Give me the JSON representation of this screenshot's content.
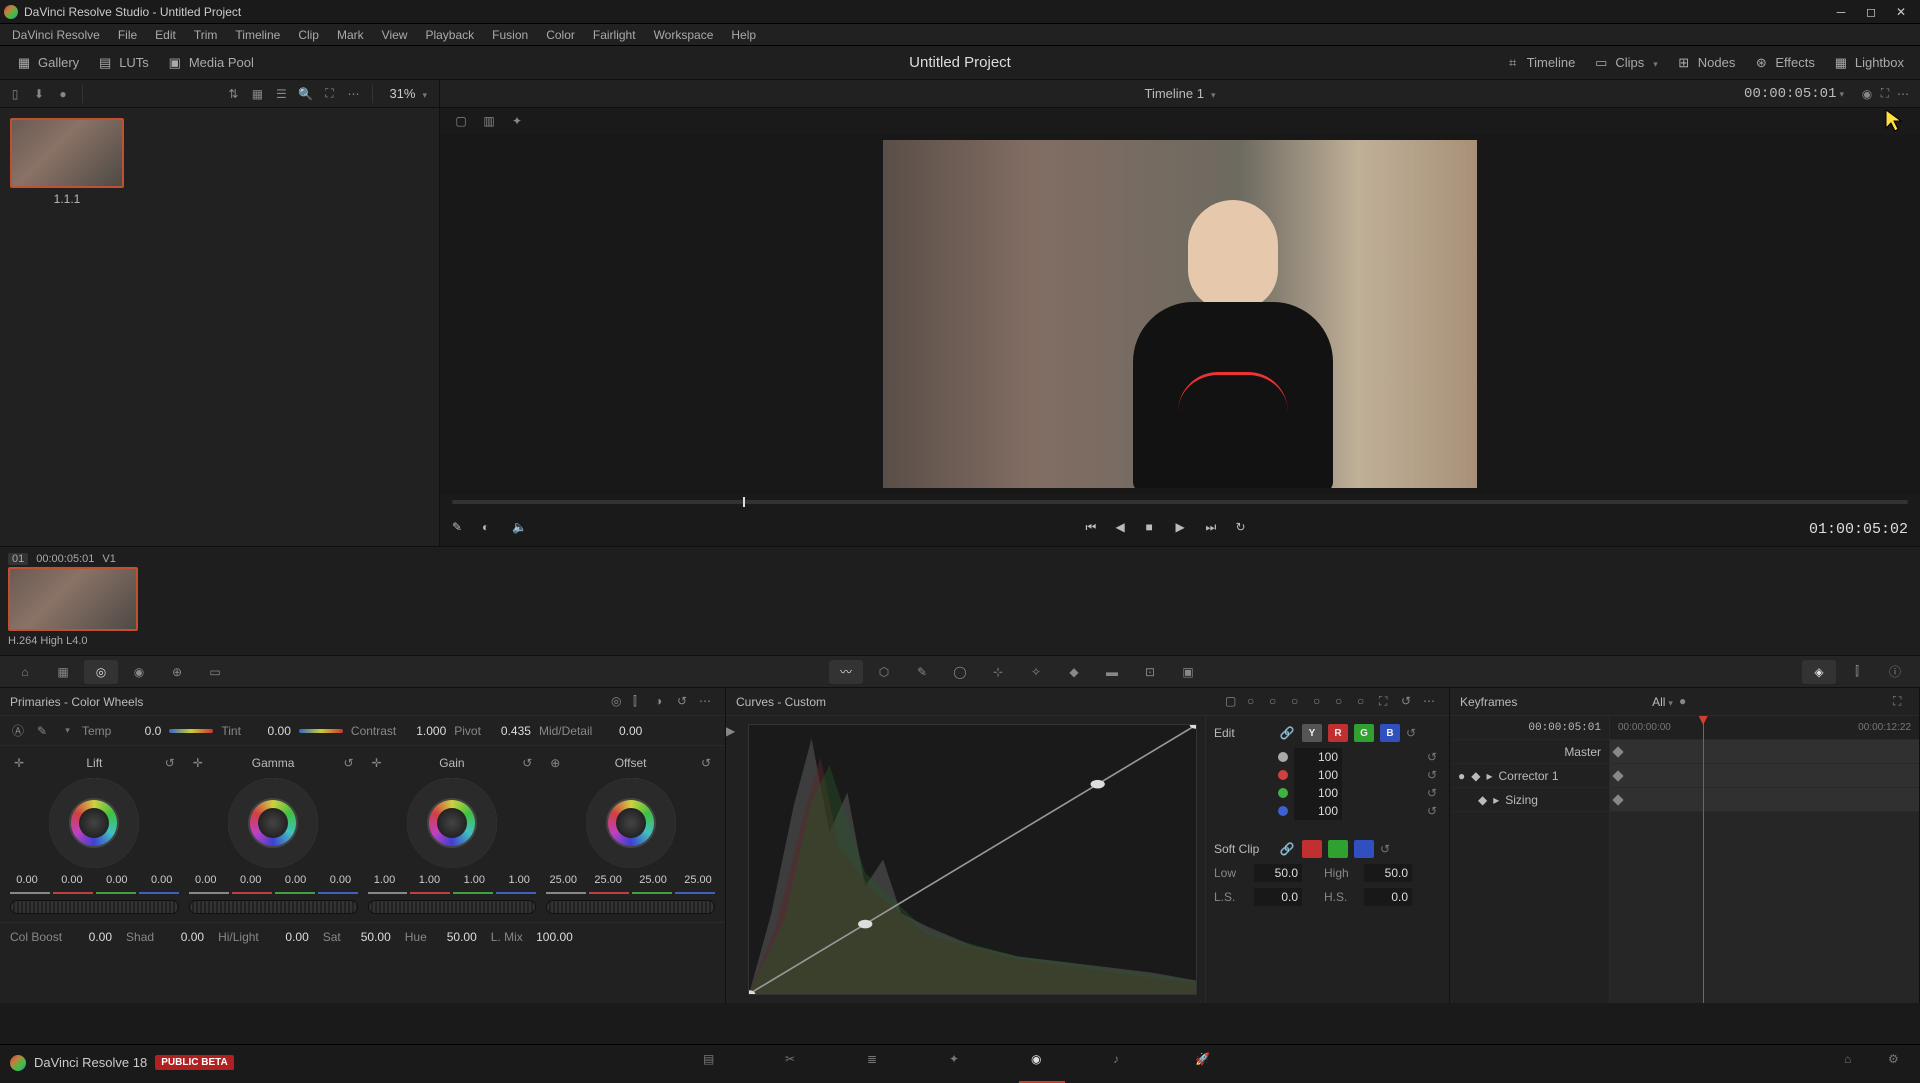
{
  "window": {
    "title": "DaVinci Resolve Studio - Untitled Project"
  },
  "menu": [
    "DaVinci Resolve",
    "File",
    "Edit",
    "Trim",
    "Timeline",
    "Clip",
    "Mark",
    "View",
    "Playback",
    "Fusion",
    "Color",
    "Fairlight",
    "Workspace",
    "Help"
  ],
  "toolbar": {
    "left": [
      {
        "name": "gallery",
        "label": "Gallery"
      },
      {
        "name": "luts",
        "label": "LUTs"
      },
      {
        "name": "media-pool",
        "label": "Media Pool"
      }
    ],
    "project_title": "Untitled Project",
    "right": [
      {
        "name": "timeline",
        "label": "Timeline"
      },
      {
        "name": "clips",
        "label": "Clips"
      },
      {
        "name": "nodes",
        "label": "Nodes"
      },
      {
        "name": "effects",
        "label": "Effects"
      },
      {
        "name": "lightbox",
        "label": "Lightbox"
      }
    ]
  },
  "gallery_head": {
    "zoom": "31%"
  },
  "viewer_head": {
    "timeline_name": "Timeline 1",
    "tc": "00:00:05:01"
  },
  "gallery": {
    "still_label": "1.1.1"
  },
  "transport": {
    "record_tc": "01:00:05:02"
  },
  "clip": {
    "index": "01",
    "tc": "00:00:05:01",
    "track": "V1",
    "codec": "H.264 High L4.0"
  },
  "primaries": {
    "title": "Primaries - Color Wheels",
    "adjust": {
      "temp_label": "Temp",
      "temp_val": "0.0",
      "tint_label": "Tint",
      "tint_val": "0.00",
      "contrast_label": "Contrast",
      "contrast_val": "1.000",
      "pivot_label": "Pivot",
      "pivot_val": "0.435",
      "md_label": "Mid/Detail",
      "md_val": "0.00"
    },
    "wheels": [
      {
        "name": "Lift",
        "vals": [
          "0.00",
          "0.00",
          "0.00",
          "0.00"
        ]
      },
      {
        "name": "Gamma",
        "vals": [
          "0.00",
          "0.00",
          "0.00",
          "0.00"
        ]
      },
      {
        "name": "Gain",
        "vals": [
          "1.00",
          "1.00",
          "1.00",
          "1.00"
        ]
      },
      {
        "name": "Offset",
        "vals": [
          "25.00",
          "25.00",
          "25.00",
          "25.00"
        ]
      }
    ],
    "bottom": {
      "colboost_label": "Col Boost",
      "colboost_val": "0.00",
      "shad_label": "Shad",
      "shad_val": "0.00",
      "hilight_label": "Hi/Light",
      "hilight_val": "0.00",
      "sat_label": "Sat",
      "sat_val": "50.00",
      "hue_label": "Hue",
      "hue_val": "50.00",
      "lmix_label": "L. Mix",
      "lmix_val": "100.00"
    }
  },
  "curves": {
    "title": "Curves - Custom",
    "edit_label": "Edit",
    "channels": [
      {
        "color": "#aaaaaa",
        "val": "100"
      },
      {
        "color": "#d04040",
        "val": "100"
      },
      {
        "color": "#40b040",
        "val": "100"
      },
      {
        "color": "#4060d0",
        "val": "100"
      }
    ],
    "softclip_label": "Soft Clip",
    "low_label": "Low",
    "low_val": "50.0",
    "high_label": "High",
    "high_val": "50.0",
    "ls_label": "L.S.",
    "ls_val": "0.0",
    "hs_label": "H.S.",
    "hs_val": "0.0"
  },
  "keyframes": {
    "title": "Keyframes",
    "all_label": "All",
    "head_tc": "00:00:05:01",
    "start_tc": "00:00:00:00",
    "end_tc": "00:00:12:22",
    "rows": [
      "Master",
      "Corrector 1",
      "Sizing"
    ]
  },
  "pagebar": {
    "product": "DaVinci Resolve 18",
    "beta": "PUBLIC BETA"
  }
}
